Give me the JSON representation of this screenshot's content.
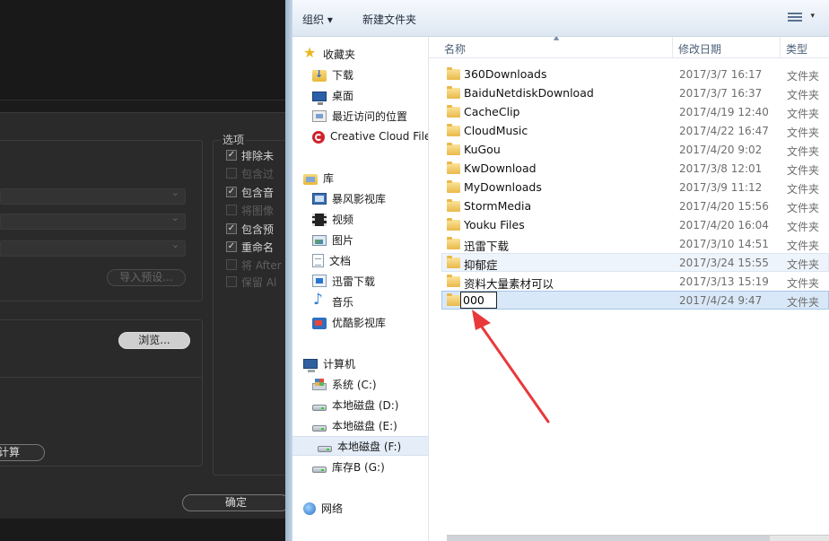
{
  "background_app": {
    "options_title": "选项",
    "options": [
      {
        "label": "排除未",
        "checked": true,
        "enabled": true
      },
      {
        "label": "包含过",
        "checked": false,
        "enabled": false
      },
      {
        "label": "包含音",
        "checked": true,
        "enabled": true
      },
      {
        "label": "将图像",
        "checked": false,
        "enabled": false
      },
      {
        "label": "包含预",
        "checked": true,
        "enabled": true
      },
      {
        "label": "重命名",
        "checked": true,
        "enabled": true
      },
      {
        "label": "将 After",
        "checked": false,
        "enabled": false
      },
      {
        "label": "保留 Al",
        "checked": false,
        "enabled": false
      }
    ],
    "import_preset_button": "导入预设...",
    "browse_button": "浏览...",
    "calculate_button": "计算",
    "ok_button": "确定"
  },
  "explorer": {
    "toolbar": {
      "organize": "组织 ▾",
      "new_folder": "新建文件夹",
      "view_arrow": "▾"
    },
    "nav": {
      "favorites": {
        "label": "收藏夹",
        "items": [
          "下载",
          "桌面",
          "最近访问的位置",
          "Creative Cloud Files"
        ]
      },
      "libraries": {
        "label": "库",
        "items": [
          "暴风影视库",
          "视频",
          "图片",
          "文档",
          "迅雷下载",
          "音乐",
          "优酷影视库"
        ]
      },
      "computer": {
        "label": "计算机",
        "items": [
          "系统 (C:)",
          "本地磁盘 (D:)",
          "本地磁盘 (E:)",
          "本地磁盘 (F:)",
          "库存B (G:)"
        ]
      },
      "network": {
        "label": "网络"
      }
    },
    "columns": {
      "name": "名称",
      "modified": "修改日期",
      "type": "类型"
    },
    "files": [
      {
        "name": "360Downloads",
        "date": "2017/3/7 16:17",
        "type": "文件夹"
      },
      {
        "name": "BaiduNetdiskDownload",
        "date": "2017/3/7 16:37",
        "type": "文件夹"
      },
      {
        "name": "CacheClip",
        "date": "2017/4/19 12:40",
        "type": "文件夹"
      },
      {
        "name": "CloudMusic",
        "date": "2017/4/22 16:47",
        "type": "文件夹"
      },
      {
        "name": "KuGou",
        "date": "2017/4/20 9:02",
        "type": "文件夹"
      },
      {
        "name": "KwDownload",
        "date": "2017/3/8 12:01",
        "type": "文件夹"
      },
      {
        "name": "MyDownloads",
        "date": "2017/3/9 11:12",
        "type": "文件夹"
      },
      {
        "name": "StormMedia",
        "date": "2017/4/20 15:56",
        "type": "文件夹"
      },
      {
        "name": "Youku Files",
        "date": "2017/4/20 16:04",
        "type": "文件夹"
      },
      {
        "name": "迅雷下载",
        "date": "2017/3/10 14:51",
        "type": "文件夹"
      },
      {
        "name": "抑郁症",
        "date": "2017/3/24 15:55",
        "type": "文件夹"
      },
      {
        "name": "资料大量素材可以",
        "date": "2017/3/13 15:19",
        "type": "文件夹"
      },
      {
        "name": "000",
        "date": "2017/4/24 9:47",
        "type": "文件夹"
      }
    ]
  },
  "colors": {
    "annotation_arrow": "#e8393b",
    "selection": "#d9e8f8"
  }
}
